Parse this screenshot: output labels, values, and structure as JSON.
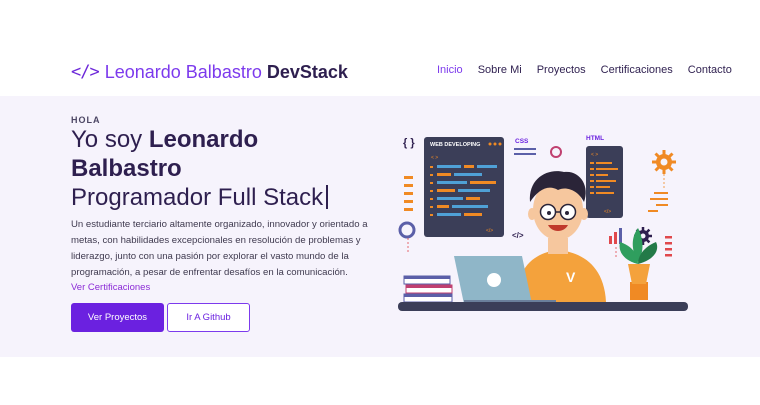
{
  "header": {
    "brand_code_glyph": "</>",
    "brand_name": "Leonardo Balbastro",
    "brand_stack": "DevStack",
    "nav": [
      "Inicio",
      "Sobre Mi",
      "Proyectos",
      "Certificaciones",
      "Contacto"
    ],
    "active_nav": "Inicio"
  },
  "hero": {
    "kicker": "HOLA",
    "title_prefix": "Yo soy",
    "title_name_line1": "Leonardo",
    "title_name_line2": "Balbastro",
    "role": "Programador Full Stack",
    "description": "Un estudiante terciario altamente organizado, innovador y orientado a metas, con habilidades excepcionales en resolución de problemas y liderazgo, junto con una pasión por explorar el vasto mundo de la programación, a pesar de enfrentar desafíos en la comunicación.",
    "cert_link": "Ver Certificaciones",
    "primary_button": "Ver Proyectos",
    "secondary_button": "Ir A Github"
  },
  "illustration": {
    "screen_title": "WEB DEVELOPING",
    "css_label": "CSS",
    "html_label": "HTML",
    "braces": "{ }",
    "code_tag": "</>",
    "code_tag_small": "</>",
    "screen_tag_open": "< >",
    "screen_tag_close": "</>",
    "laptop_letter": "V",
    "icons": [
      "braces-icon",
      "gear-icon",
      "cog-icon",
      "plant-icon",
      "books-icon",
      "laptop-icon"
    ],
    "colors": {
      "accent": "#6b21e0",
      "screen": "#3b3e58",
      "orange": "#f08a24",
      "shirt": "#f4a23c",
      "laptop": "#8fb6c8",
      "plant": "#2f9e5e"
    }
  }
}
